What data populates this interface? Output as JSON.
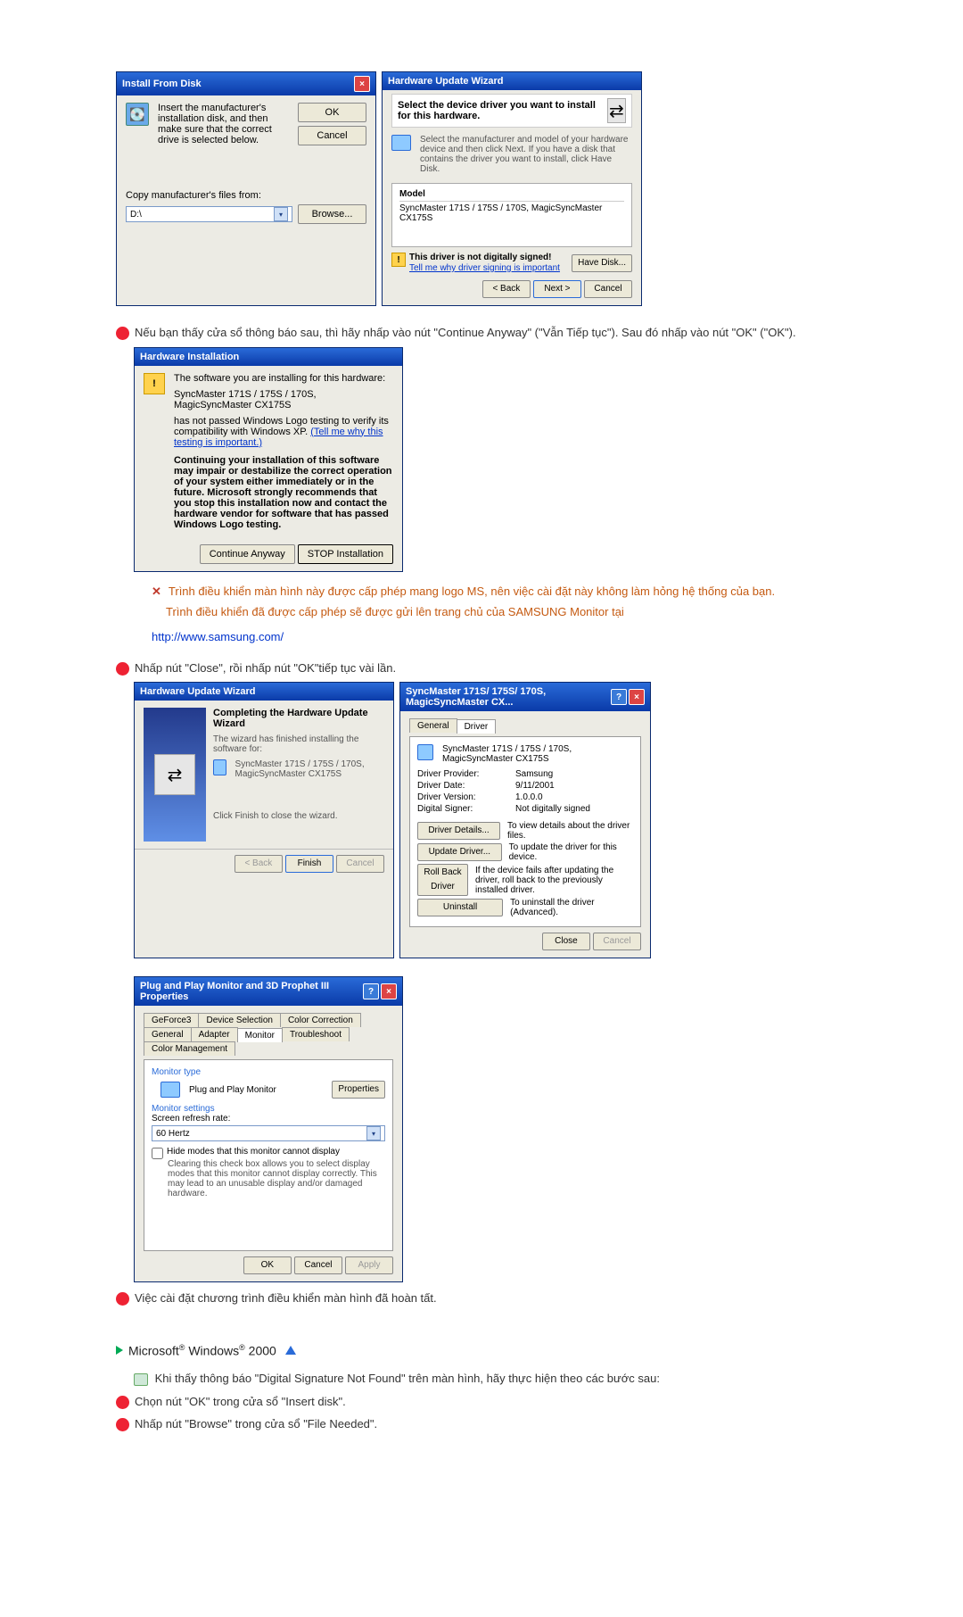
{
  "dlg_install": {
    "title": "Install From Disk",
    "instruction": "Insert the manufacturer's installation disk, and then make sure that the correct drive is selected below.",
    "ok": "OK",
    "cancel": "Cancel",
    "copy_label": "Copy manufacturer's files from:",
    "drive_value": "D:\\",
    "browse": "Browse..."
  },
  "dlg_hw_update_select": {
    "title": "Hardware Update Wizard",
    "subtitle": "Select the device driver you want to install for this hardware.",
    "helper": "Select the manufacturer and model of your hardware device and then click Next. If you have a disk that contains the driver you want to install, click Have Disk.",
    "model_label": "Model",
    "model_value": "SyncMaster 171S / 175S / 170S, MagicSyncMaster CX175S",
    "not_signed": "This driver is not digitally signed!",
    "tell_me": "Tell me why driver signing is important",
    "have_disk": "Have Disk...",
    "back": "< Back",
    "next": "Next >",
    "cancel": "Cancel"
  },
  "step8": "Nếu bạn thấy cửa sổ thông báo sau, thì hãy nhấp vào nút \"Continue Anyway\" (\"Vẫn Tiếp tục\"). Sau đó nhấp vào nút \"OK\" (\"OK\").",
  "dlg_hw_install_warn": {
    "title": "Hardware Installation",
    "line1": "The software you are installing for this hardware:",
    "line2": "SyncMaster 171S / 175S / 170S, MagicSyncMaster CX175S",
    "line3": "has not passed Windows Logo testing to verify its compatibility with Windows XP. ",
    "tell_me": "(Tell me why this testing is important.)",
    "warn": "Continuing your installation of this software may impair or destabilize the correct operation of your system either immediately or in the future. Microsoft strongly recommends that you stop this installation now and contact the hardware vendor for software that has passed Windows Logo testing.",
    "continue": "Continue Anyway",
    "stop": "STOP Installation"
  },
  "orange_note1": "Trình điều khiển màn hình này được cấp phép mang logo MS, nên việc cài đặt này không làm hỏng hệ thống của bạn.",
  "orange_note2": "Trình điều khiển đã được cấp phép sẽ được gửi lên trang chủ của SAMSUNG Monitor tại",
  "samsung_url": "http://www.samsung.com/",
  "step9": "Nhấp nút \"Close\", rồi nhấp nút \"OK\"tiếp tục vài lần.",
  "dlg_complete": {
    "title": "Hardware Update Wizard",
    "heading": "Completing the Hardware Update Wizard",
    "line1": "The wizard has finished installing the software for:",
    "device": "SyncMaster 171S / 175S / 170S, MagicSyncMaster CX175S",
    "click_finish": "Click Finish to close the wizard.",
    "back": "< Back",
    "finish": "Finish",
    "cancel": "Cancel"
  },
  "dlg_driver_props": {
    "title": "SyncMaster 171S/ 175S/ 170S, MagicSyncMaster CX...",
    "tabs": {
      "general": "General",
      "driver": "Driver"
    },
    "device": "SyncMaster 171S / 175S / 170S, MagicSyncMaster CX175S",
    "provider_k": "Driver Provider:",
    "provider_v": "Samsung",
    "date_k": "Driver Date:",
    "date_v": "9/11/2001",
    "version_k": "Driver Version:",
    "version_v": "1.0.0.0",
    "signer_k": "Digital Signer:",
    "signer_v": "Not digitally signed",
    "details_btn": "Driver Details...",
    "details_txt": "To view details about the driver files.",
    "update_btn": "Update Driver...",
    "update_txt": "To update the driver for this device.",
    "rollback_btn": "Roll Back Driver",
    "rollback_txt": "If the device fails after updating the driver, roll back to the previously installed driver.",
    "uninstall_btn": "Uninstall",
    "uninstall_txt": "To uninstall the driver (Advanced).",
    "close": "Close",
    "cancel": "Cancel"
  },
  "dlg_pnp": {
    "title": "Plug and Play Monitor and 3D Prophet III Properties",
    "tabs": [
      "GeForce3",
      "Device Selection",
      "Color Correction",
      "General",
      "Adapter",
      "Monitor",
      "Troubleshoot",
      "Color Management"
    ],
    "active_tab_index": 5,
    "mtype_label": "Monitor type",
    "mtype_value": "Plug and Play Monitor",
    "properties_btn": "Properties",
    "msettings_label": "Monitor settings",
    "refresh_label": "Screen refresh rate:",
    "refresh_value": "60 Hertz",
    "hide_modes": "Hide modes that this monitor cannot display",
    "hide_help": "Clearing this check box allows you to select display modes that this monitor cannot display correctly. This may lead to an unusable display and/or damaged hardware.",
    "ok": "OK",
    "cancel": "Cancel",
    "apply": "Apply"
  },
  "step10": "Việc cài đặt chương trình điều khiển màn hình đã hoàn tất.",
  "os_heading_pre": "Microsoft",
  "os_heading_mid": " Windows",
  "os_heading_post": " 2000",
  "win2000_intro": "Khi thấy thông báo \"Digital Signature Not Found\" trên màn hình, hãy thực hiện theo các bước sau:",
  "win2000_step1": "Chọn nút \"OK\" trong cửa sổ \"Insert disk\".",
  "win2000_step2": "Nhấp nút \"Browse\" trong cửa sổ \"File Needed\"."
}
